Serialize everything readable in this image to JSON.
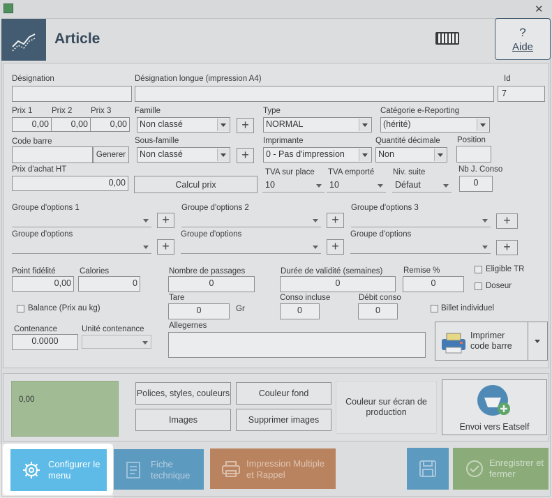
{
  "window": {
    "close": "✕"
  },
  "header": {
    "title": "Article",
    "help_q": "?",
    "help_label": "Aide"
  },
  "labels": {
    "designation": "Désignation",
    "designation_longue": "Désignation longue (impression A4)",
    "id": "Id",
    "prix1": "Prix 1",
    "prix2": "Prix 2",
    "prix3": "Prix 3",
    "famille": "Famille",
    "type": "Type",
    "categorie": "Catégorie e-Reporting",
    "code_barre": "Code barre",
    "sous_famille": "Sous-famille",
    "imprimante": "Imprimante",
    "quantite_decimale": "Quantité décimale",
    "position": "Position",
    "prix_achat": "Prix d'achat HT",
    "tva_place": "TVA sur place",
    "tva_emporte": "TVA emporté",
    "niv_suite": "Niv. suite",
    "nb_conso": "Nb J. Conso",
    "groupe1": "Groupe d'options 1",
    "groupe2": "Groupe d'options 2",
    "groupe3": "Groupe d'options 3",
    "groupe4": "Groupe d'options",
    "groupe5": "Groupe d'options",
    "groupe6": "Groupe d'options",
    "point_fidelite": "Point fidélité",
    "calories": "Calories",
    "nombre_passages": "Nombre de passages",
    "duree_validite": "Durée de validité (semaines)",
    "remise": "Remise %",
    "eligible_tr": "Eligible TR",
    "doseur": "Doseur",
    "balance": "Balance (Prix au kg)",
    "tare": "Tare",
    "gr": "Gr",
    "conso_incluse": "Conso incluse",
    "debit_conso": "Débit conso",
    "billet_individuel": "Billet individuel",
    "contenance": "Contenance",
    "unite_contenance": "Unité contenance",
    "allergenes": "Allegernes"
  },
  "values": {
    "id": "7",
    "prix1": "0,00",
    "prix2": "0,00",
    "prix3": "0,00",
    "famille": "Non classé",
    "type": "NORMAL",
    "categorie": "(hérité)",
    "sous_famille": "Non classé",
    "imprimante": "0 - Pas d'impression",
    "quantite_decimale": "Non",
    "prix_achat": "0,00",
    "tva_place": "10",
    "tva_emporte": "10",
    "niv_suite": "Défaut",
    "nb_conso": "0",
    "point_fidelite": "0,00",
    "calories": "0",
    "nombre_passages": "0",
    "duree_validite": "0",
    "remise": "0",
    "tare": "0",
    "conso_incluse": "0",
    "debit_conso": "0",
    "contenance": "0.0000",
    "preview": "0,00"
  },
  "buttons": {
    "plus": "+",
    "generer": "Generer",
    "calcul_prix": "Calcul prix",
    "imprimer_code_barre": "Imprimer code barre",
    "polices": "Polices, styles, couleurs",
    "couleur_fond": "Couleur fond",
    "images": "Images",
    "supprimer_images": "Supprimer images",
    "couleur_ecran": "Couleur sur écran de production",
    "envoi_eatself": "Envoi vers Eatself",
    "configurer_menu": "Configurer le menu",
    "fiche_technique": "Fiche technique",
    "impression_multiple": "Impression Multiple et Rappel",
    "enregistrer": "Enregistrer et fermer"
  },
  "colors": {
    "header_icon_bg": "#2f4b63",
    "preview_green": "#a2c08f",
    "configurer_blue": "#5ebbe7",
    "fiche_blue": "#4f97c4",
    "impression_orange": "#c07a4d",
    "save_blue": "#4f97c4",
    "enregistrer_green": "#87ad6d"
  }
}
